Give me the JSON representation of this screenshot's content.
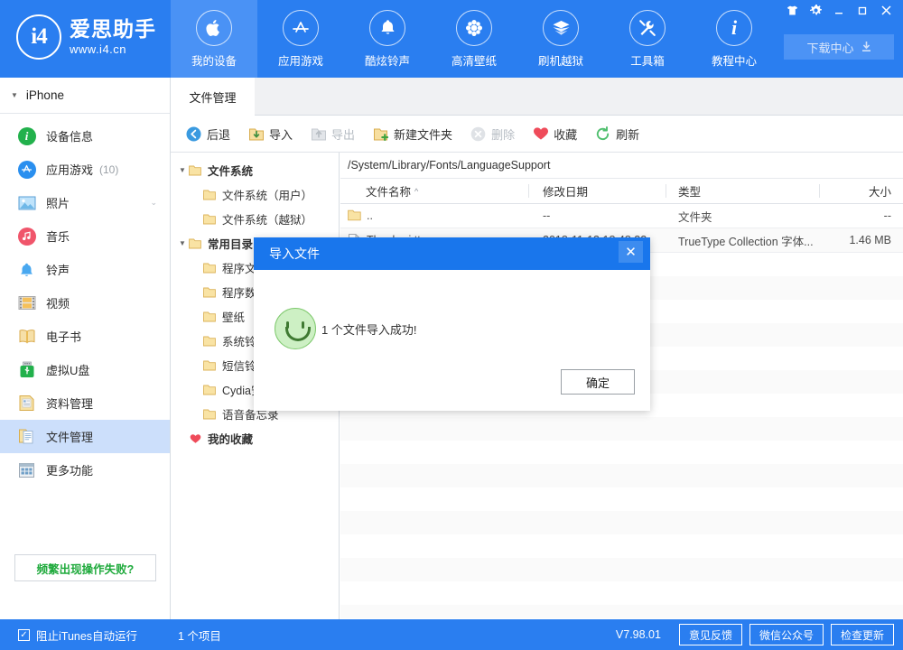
{
  "header": {
    "logo": {
      "mark": "i4",
      "title": "爱思助手",
      "url": "www.i4.cn"
    },
    "nav": [
      {
        "label": "我的设备",
        "icon": "apple-icon",
        "active": true
      },
      {
        "label": "应用游戏",
        "icon": "appstore-icon",
        "active": false
      },
      {
        "label": "酷炫铃声",
        "icon": "bell-icon",
        "active": false
      },
      {
        "label": "高清壁纸",
        "icon": "flower-icon",
        "active": false
      },
      {
        "label": "刷机越狱",
        "icon": "box-icon",
        "active": false
      },
      {
        "label": "工具箱",
        "icon": "tools-icon",
        "active": false
      },
      {
        "label": "教程中心",
        "icon": "info-icon",
        "active": false
      }
    ],
    "window_buttons": [
      {
        "name": "skin",
        "glyph": "skin-icon"
      },
      {
        "name": "settings",
        "glyph": "gear-icon"
      },
      {
        "name": "minimize",
        "glyph": "minimize-icon"
      },
      {
        "name": "maximize",
        "glyph": "maximize-icon"
      },
      {
        "name": "close",
        "glyph": "close-icon"
      }
    ],
    "download_center": {
      "label": "下载中心",
      "icon": "download-icon"
    }
  },
  "sidebar": {
    "device": {
      "name": "iPhone",
      "caret": "▼"
    },
    "items": [
      {
        "label": "设备信息",
        "count": "",
        "icon": "info-icon",
        "color": "#22b14c",
        "shape": "round",
        "active": false,
        "chevron": ""
      },
      {
        "label": "应用游戏",
        "count": "(10)",
        "icon": "appstore-icon",
        "color": "#2a8fef",
        "shape": "round",
        "active": false,
        "chevron": ""
      },
      {
        "label": "照片",
        "count": "",
        "icon": "photo-icon",
        "color": "#4aa3ef",
        "shape": "square",
        "active": false,
        "chevron": "⌄"
      },
      {
        "label": "音乐",
        "count": "",
        "icon": "music-icon",
        "color": "#f0556b",
        "shape": "round",
        "active": false,
        "chevron": ""
      },
      {
        "label": "铃声",
        "count": "",
        "icon": "bell-icon",
        "color": "#49a8f0",
        "shape": "plain",
        "active": false,
        "chevron": ""
      },
      {
        "label": "视频",
        "count": "",
        "icon": "video-icon",
        "color": "#f5b942",
        "shape": "square",
        "active": false,
        "chevron": ""
      },
      {
        "label": "电子书",
        "count": "",
        "icon": "book-icon",
        "color": "#f2c14e",
        "shape": "plain",
        "active": false,
        "chevron": ""
      },
      {
        "label": "虚拟U盘",
        "count": "",
        "icon": "usb-icon",
        "color": "#22b14c",
        "shape": "plain",
        "active": false,
        "chevron": ""
      },
      {
        "label": "资料管理",
        "count": "",
        "icon": "docs-icon",
        "color": "#f2d07a",
        "shape": "plain",
        "active": false,
        "chevron": ""
      },
      {
        "label": "文件管理",
        "count": "",
        "icon": "files-icon",
        "color": "#f2d07a",
        "shape": "plain",
        "active": true,
        "chevron": ""
      },
      {
        "label": "更多功能",
        "count": "",
        "icon": "grid-icon",
        "color": "#9aa7b4",
        "shape": "plain",
        "active": false,
        "chevron": ""
      }
    ],
    "help_button": {
      "label": "频繁出现操作失败?",
      "color": "#1faa3c"
    }
  },
  "tabs": [
    {
      "label": "文件管理",
      "active": true
    }
  ],
  "toolbar": [
    {
      "label": "后退",
      "icon": "back-icon",
      "disabled": false
    },
    {
      "label": "导入",
      "icon": "import-icon",
      "disabled": false
    },
    {
      "label": "导出",
      "icon": "export-icon",
      "disabled": true
    },
    {
      "label": "新建文件夹",
      "icon": "newfolder-icon",
      "disabled": false
    },
    {
      "label": "删除",
      "icon": "delete-icon",
      "disabled": true
    },
    {
      "label": "收藏",
      "icon": "heart-icon",
      "disabled": false
    },
    {
      "label": "刷新",
      "icon": "refresh-icon",
      "disabled": false
    }
  ],
  "tree": [
    {
      "label": "文件系统",
      "caret": "▼",
      "bold": true,
      "indent": 0,
      "icon": "folder-icon"
    },
    {
      "label": "文件系统（用户）",
      "caret": "",
      "bold": false,
      "indent": 1,
      "icon": "folder-icon"
    },
    {
      "label": "文件系统（越狱）",
      "caret": "",
      "bold": false,
      "indent": 1,
      "icon": "folder-icon"
    },
    {
      "label": "常用目录",
      "caret": "▼",
      "bold": true,
      "indent": 0,
      "icon": "folder-icon"
    },
    {
      "label": "程序文档",
      "caret": "",
      "bold": false,
      "indent": 1,
      "icon": "folder-icon"
    },
    {
      "label": "程序数据",
      "caret": "",
      "bold": false,
      "indent": 1,
      "icon": "folder-icon"
    },
    {
      "label": "壁纸",
      "caret": "",
      "bold": false,
      "indent": 1,
      "icon": "folder-icon"
    },
    {
      "label": "系统铃声",
      "caret": "",
      "bold": false,
      "indent": 1,
      "icon": "folder-icon"
    },
    {
      "label": "短信铃声",
      "caret": "",
      "bold": false,
      "indent": 1,
      "icon": "folder-icon"
    },
    {
      "label": "Cydia安装包",
      "caret": "",
      "bold": false,
      "indent": 1,
      "icon": "folder-icon"
    },
    {
      "label": "语音备忘录",
      "caret": "",
      "bold": false,
      "indent": 1,
      "icon": "folder-icon"
    },
    {
      "label": "我的收藏",
      "caret": "",
      "bold": true,
      "indent": 0,
      "icon": "heart-icon"
    }
  ],
  "file_pane": {
    "path": "/System/Library/Fonts/LanguageSupport",
    "columns": [
      {
        "label": "文件名称",
        "sort": "^"
      },
      {
        "label": "修改日期",
        "sort": ""
      },
      {
        "label": "类型",
        "sort": ""
      },
      {
        "label": "大小",
        "sort": ""
      }
    ],
    "rows": [
      {
        "name": "..",
        "icon": "folder-icon",
        "date": "--",
        "type": "文件夹",
        "size": "--"
      },
      {
        "name": "Thonburi.ttc",
        "icon": "font-icon",
        "date": "2018-11-13 18:48:32",
        "type": "TrueType Collection 字体...",
        "size": "1.46 MB"
      }
    ]
  },
  "modal": {
    "title": "导入文件",
    "close": "✕",
    "icon": "smiley-success-icon",
    "message": "1 个文件导入成功!",
    "ok_label": "确定"
  },
  "statusbar": {
    "checkbox": {
      "label": "阻止iTunes自动运行",
      "checked": "✓"
    },
    "count": "1 个项目",
    "version": "V7.98.01",
    "buttons": [
      {
        "label": "意见反馈"
      },
      {
        "label": "微信公众号"
      },
      {
        "label": "检查更新"
      }
    ]
  },
  "colors": {
    "brand_blue": "#2a7ef0",
    "nav_active": "#4a92f5",
    "sidebar_active": "#ccdffb",
    "modal_header": "#1976ec",
    "success_green": "#1faa3c",
    "heart_red": "#ef4b5a"
  }
}
